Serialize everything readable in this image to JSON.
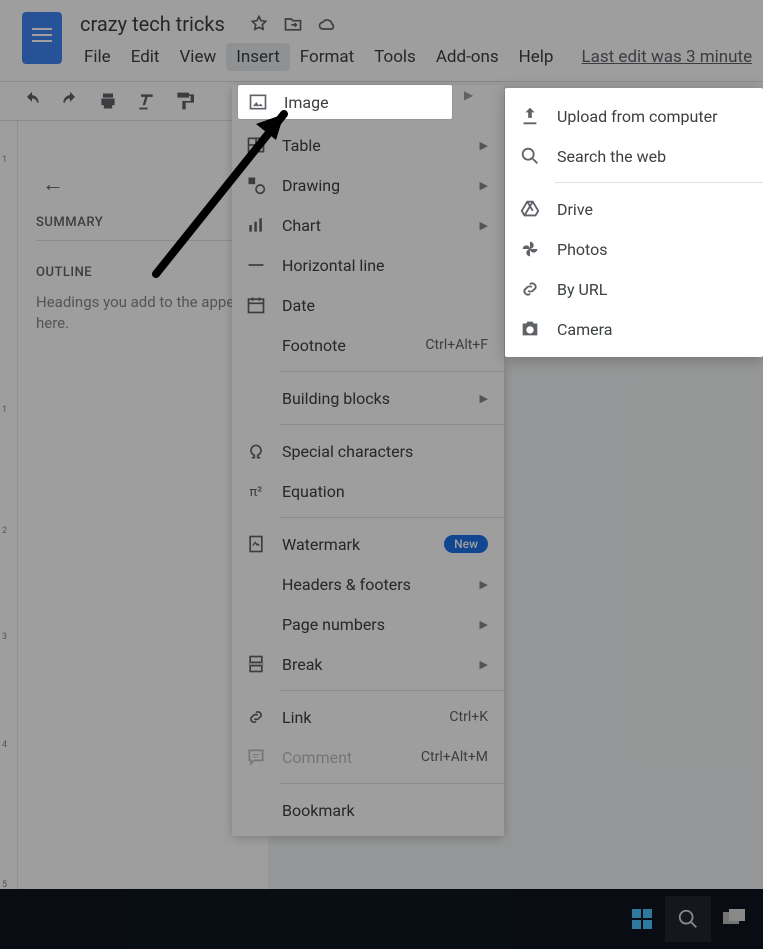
{
  "header": {
    "title": "crazy tech tricks",
    "menus": [
      "File",
      "Edit",
      "View",
      "Insert",
      "Format",
      "Tools",
      "Add-ons",
      "Help"
    ],
    "active_menu_index": 3,
    "last_edit": "Last edit was 3 minute"
  },
  "sidebar": {
    "summary_label": "SUMMARY",
    "outline_label": "OUTLINE",
    "outline_hint": "Headings you add to the appear here."
  },
  "insert_menu": {
    "highlighted": {
      "label": "Image"
    },
    "items": [
      {
        "label": "Table",
        "arrow": true,
        "icon": "table"
      },
      {
        "label": "Drawing",
        "arrow": true,
        "icon": "drawing"
      },
      {
        "label": "Chart",
        "arrow": true,
        "icon": "chart"
      },
      {
        "label": "Horizontal line",
        "icon": "hline"
      },
      {
        "label": "Date",
        "icon": "date"
      },
      {
        "label": "Footnote",
        "shortcut": "Ctrl+Alt+F"
      },
      {
        "sep": true
      },
      {
        "label": "Building blocks",
        "arrow": true
      },
      {
        "sep": true
      },
      {
        "label": "Special characters",
        "icon": "omega"
      },
      {
        "label": "Equation",
        "icon": "pi"
      },
      {
        "sep": true
      },
      {
        "label": "Watermark",
        "icon": "watermark",
        "badge": "New"
      },
      {
        "label": "Headers & footers",
        "arrow": true
      },
      {
        "label": "Page numbers",
        "arrow": true
      },
      {
        "label": "Break",
        "arrow": true,
        "icon": "break"
      },
      {
        "sep": true
      },
      {
        "label": "Link",
        "shortcut": "Ctrl+K",
        "icon": "link"
      },
      {
        "label": "Comment",
        "shortcut": "Ctrl+Alt+M",
        "icon": "comment",
        "disabled": true
      },
      {
        "sep": true
      },
      {
        "label": "Bookmark"
      }
    ]
  },
  "image_submenu": [
    {
      "label": "Upload from computer",
      "icon": "upload"
    },
    {
      "label": "Search the web",
      "icon": "search"
    },
    {
      "sep": true
    },
    {
      "label": "Drive",
      "icon": "drive"
    },
    {
      "label": "Photos",
      "icon": "photos"
    },
    {
      "label": "By URL",
      "icon": "url"
    },
    {
      "label": "Camera",
      "icon": "camera"
    }
  ],
  "ruler_ticks": [
    "1",
    "1",
    "2",
    "3",
    "4",
    "5"
  ]
}
